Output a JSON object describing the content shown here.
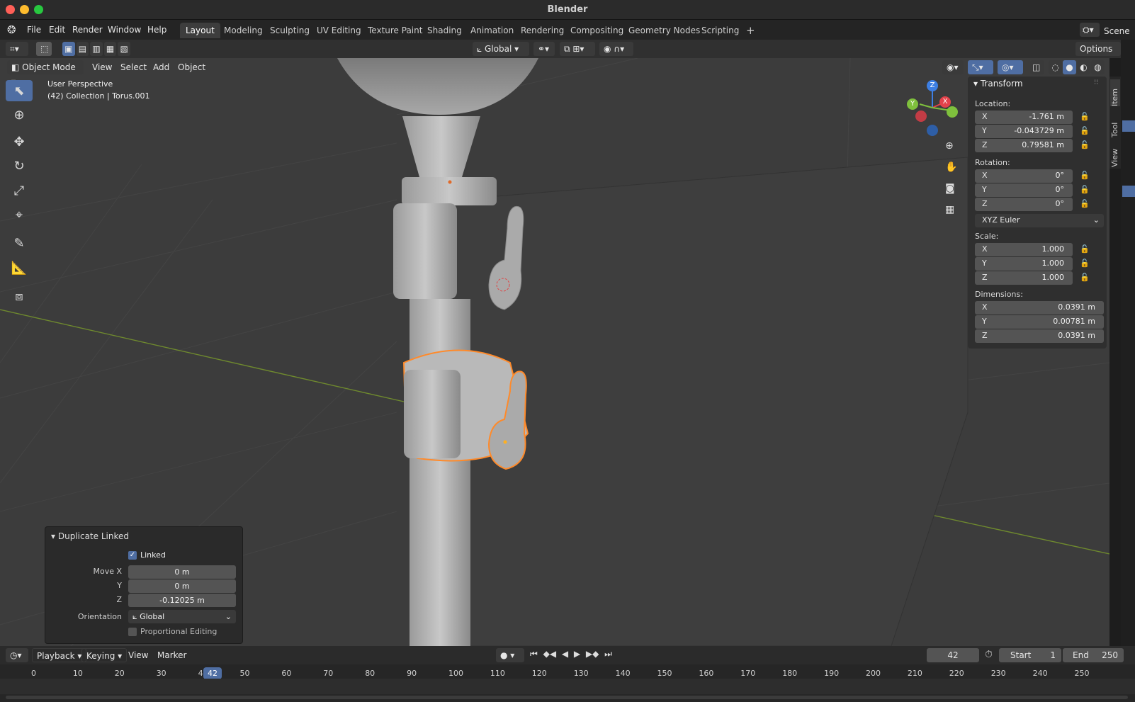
{
  "app": {
    "title": "Blender"
  },
  "menu": [
    "File",
    "Edit",
    "Render",
    "Window",
    "Help"
  ],
  "workspaces": [
    "Layout",
    "Modeling",
    "Sculpting",
    "UV Editing",
    "Texture Paint",
    "Shading",
    "Animation",
    "Rendering",
    "Compositing",
    "Geometry Nodes",
    "Scripting"
  ],
  "scene_label": "Scene",
  "toolbar": {
    "orientation": "Global",
    "options": "Options"
  },
  "header": {
    "mode": "Object Mode",
    "items": [
      "View",
      "Select",
      "Add",
      "Object"
    ]
  },
  "viewport": {
    "perspective": "User Perspective",
    "selection": "(42) Collection | Torus.001"
  },
  "gizmo": {
    "z": "Z",
    "y": "Y",
    "x": "X"
  },
  "npanel": {
    "title": "Transform",
    "location_label": "Location:",
    "location": [
      {
        "axis": "X",
        "value": "-1.761 m"
      },
      {
        "axis": "Y",
        "value": "-0.043729 m"
      },
      {
        "axis": "Z",
        "value": "0.79581 m"
      }
    ],
    "rotation_label": "Rotation:",
    "rotation": [
      {
        "axis": "X",
        "value": "0°"
      },
      {
        "axis": "Y",
        "value": "0°"
      },
      {
        "axis": "Z",
        "value": "0°"
      }
    ],
    "rotation_mode": "XYZ Euler",
    "scale_label": "Scale:",
    "scale": [
      {
        "axis": "X",
        "value": "1.000"
      },
      {
        "axis": "Y",
        "value": "1.000"
      },
      {
        "axis": "Z",
        "value": "1.000"
      }
    ],
    "dimensions_label": "Dimensions:",
    "dimensions": [
      {
        "axis": "X",
        "value": "0.0391 m"
      },
      {
        "axis": "Y",
        "value": "0.00781 m"
      },
      {
        "axis": "Z",
        "value": "0.0391 m"
      }
    ],
    "tabs": [
      "Item",
      "Tool",
      "View"
    ]
  },
  "redo_panel": {
    "title": "Duplicate Linked",
    "linked_label": "Linked",
    "move_x_label": "Move X",
    "move_x": "0 m",
    "move_y_label": "Y",
    "move_y": "0 m",
    "move_z_label": "Z",
    "move_z": "-0.12025 m",
    "orientation_label": "Orientation",
    "orientation": "Global",
    "proportional_label": "Proportional Editing"
  },
  "timeline": {
    "menus": [
      "Playback",
      "Keying",
      "View",
      "Marker"
    ],
    "current_frame": "42",
    "start_label": "Start",
    "start": "1",
    "end_label": "End",
    "end": "250",
    "ticks": [
      "0",
      "10",
      "20",
      "30",
      "40",
      "50",
      "60",
      "70",
      "80",
      "90",
      "100",
      "110",
      "120",
      "130",
      "140",
      "150",
      "160",
      "170",
      "180",
      "190",
      "200",
      "210",
      "220",
      "230",
      "240",
      "250"
    ],
    "playhead": "42"
  },
  "colors": {
    "accent": "#4f6ea3",
    "selection_outline": "#ff8a2a",
    "x_axis": "#e3424b",
    "y_axis": "#7fc03d",
    "z_axis": "#3d7fe3"
  }
}
